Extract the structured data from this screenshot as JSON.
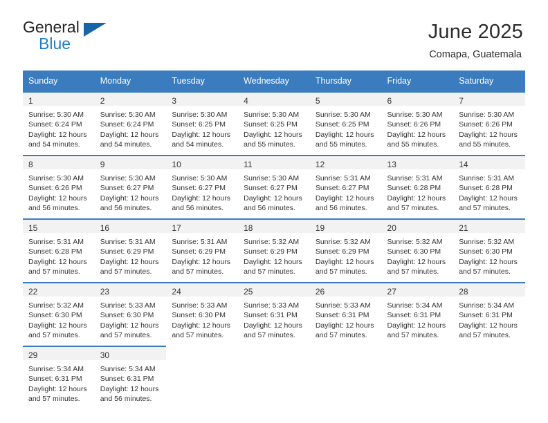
{
  "logo": {
    "line1": "General",
    "line2": "Blue",
    "triangle_color": "#1565a8",
    "blue_color": "#1d7fc4"
  },
  "header": {
    "title": "June 2025",
    "subtitle": "Comapa, Guatemala"
  },
  "theme": {
    "header_blue": "#3a7cbe",
    "day_band_gray": "#f2f2f2",
    "text": "#333333"
  },
  "calendar": {
    "weekday_headers": [
      "Sunday",
      "Monday",
      "Tuesday",
      "Wednesday",
      "Thursday",
      "Friday",
      "Saturday"
    ],
    "weeks": [
      [
        {
          "day": "1",
          "sunrise": "Sunrise: 5:30 AM",
          "sunset": "Sunset: 6:24 PM",
          "daylight": "Daylight: 12 hours and 54 minutes."
        },
        {
          "day": "2",
          "sunrise": "Sunrise: 5:30 AM",
          "sunset": "Sunset: 6:24 PM",
          "daylight": "Daylight: 12 hours and 54 minutes."
        },
        {
          "day": "3",
          "sunrise": "Sunrise: 5:30 AM",
          "sunset": "Sunset: 6:25 PM",
          "daylight": "Daylight: 12 hours and 54 minutes."
        },
        {
          "day": "4",
          "sunrise": "Sunrise: 5:30 AM",
          "sunset": "Sunset: 6:25 PM",
          "daylight": "Daylight: 12 hours and 55 minutes."
        },
        {
          "day": "5",
          "sunrise": "Sunrise: 5:30 AM",
          "sunset": "Sunset: 6:25 PM",
          "daylight": "Daylight: 12 hours and 55 minutes."
        },
        {
          "day": "6",
          "sunrise": "Sunrise: 5:30 AM",
          "sunset": "Sunset: 6:26 PM",
          "daylight": "Daylight: 12 hours and 55 minutes."
        },
        {
          "day": "7",
          "sunrise": "Sunrise: 5:30 AM",
          "sunset": "Sunset: 6:26 PM",
          "daylight": "Daylight: 12 hours and 55 minutes."
        }
      ],
      [
        {
          "day": "8",
          "sunrise": "Sunrise: 5:30 AM",
          "sunset": "Sunset: 6:26 PM",
          "daylight": "Daylight: 12 hours and 56 minutes."
        },
        {
          "day": "9",
          "sunrise": "Sunrise: 5:30 AM",
          "sunset": "Sunset: 6:27 PM",
          "daylight": "Daylight: 12 hours and 56 minutes."
        },
        {
          "day": "10",
          "sunrise": "Sunrise: 5:30 AM",
          "sunset": "Sunset: 6:27 PM",
          "daylight": "Daylight: 12 hours and 56 minutes."
        },
        {
          "day": "11",
          "sunrise": "Sunrise: 5:30 AM",
          "sunset": "Sunset: 6:27 PM",
          "daylight": "Daylight: 12 hours and 56 minutes."
        },
        {
          "day": "12",
          "sunrise": "Sunrise: 5:31 AM",
          "sunset": "Sunset: 6:27 PM",
          "daylight": "Daylight: 12 hours and 56 minutes."
        },
        {
          "day": "13",
          "sunrise": "Sunrise: 5:31 AM",
          "sunset": "Sunset: 6:28 PM",
          "daylight": "Daylight: 12 hours and 57 minutes."
        },
        {
          "day": "14",
          "sunrise": "Sunrise: 5:31 AM",
          "sunset": "Sunset: 6:28 PM",
          "daylight": "Daylight: 12 hours and 57 minutes."
        }
      ],
      [
        {
          "day": "15",
          "sunrise": "Sunrise: 5:31 AM",
          "sunset": "Sunset: 6:28 PM",
          "daylight": "Daylight: 12 hours and 57 minutes."
        },
        {
          "day": "16",
          "sunrise": "Sunrise: 5:31 AM",
          "sunset": "Sunset: 6:29 PM",
          "daylight": "Daylight: 12 hours and 57 minutes."
        },
        {
          "day": "17",
          "sunrise": "Sunrise: 5:31 AM",
          "sunset": "Sunset: 6:29 PM",
          "daylight": "Daylight: 12 hours and 57 minutes."
        },
        {
          "day": "18",
          "sunrise": "Sunrise: 5:32 AM",
          "sunset": "Sunset: 6:29 PM",
          "daylight": "Daylight: 12 hours and 57 minutes."
        },
        {
          "day": "19",
          "sunrise": "Sunrise: 5:32 AM",
          "sunset": "Sunset: 6:29 PM",
          "daylight": "Daylight: 12 hours and 57 minutes."
        },
        {
          "day": "20",
          "sunrise": "Sunrise: 5:32 AM",
          "sunset": "Sunset: 6:30 PM",
          "daylight": "Daylight: 12 hours and 57 minutes."
        },
        {
          "day": "21",
          "sunrise": "Sunrise: 5:32 AM",
          "sunset": "Sunset: 6:30 PM",
          "daylight": "Daylight: 12 hours and 57 minutes."
        }
      ],
      [
        {
          "day": "22",
          "sunrise": "Sunrise: 5:32 AM",
          "sunset": "Sunset: 6:30 PM",
          "daylight": "Daylight: 12 hours and 57 minutes."
        },
        {
          "day": "23",
          "sunrise": "Sunrise: 5:33 AM",
          "sunset": "Sunset: 6:30 PM",
          "daylight": "Daylight: 12 hours and 57 minutes."
        },
        {
          "day": "24",
          "sunrise": "Sunrise: 5:33 AM",
          "sunset": "Sunset: 6:30 PM",
          "daylight": "Daylight: 12 hours and 57 minutes."
        },
        {
          "day": "25",
          "sunrise": "Sunrise: 5:33 AM",
          "sunset": "Sunset: 6:31 PM",
          "daylight": "Daylight: 12 hours and 57 minutes."
        },
        {
          "day": "26",
          "sunrise": "Sunrise: 5:33 AM",
          "sunset": "Sunset: 6:31 PM",
          "daylight": "Daylight: 12 hours and 57 minutes."
        },
        {
          "day": "27",
          "sunrise": "Sunrise: 5:34 AM",
          "sunset": "Sunset: 6:31 PM",
          "daylight": "Daylight: 12 hours and 57 minutes."
        },
        {
          "day": "28",
          "sunrise": "Sunrise: 5:34 AM",
          "sunset": "Sunset: 6:31 PM",
          "daylight": "Daylight: 12 hours and 57 minutes."
        }
      ],
      [
        {
          "day": "29",
          "sunrise": "Sunrise: 5:34 AM",
          "sunset": "Sunset: 6:31 PM",
          "daylight": "Daylight: 12 hours and 57 minutes."
        },
        {
          "day": "30",
          "sunrise": "Sunrise: 5:34 AM",
          "sunset": "Sunset: 6:31 PM",
          "daylight": "Daylight: 12 hours and 56 minutes."
        },
        null,
        null,
        null,
        null,
        null
      ]
    ]
  }
}
